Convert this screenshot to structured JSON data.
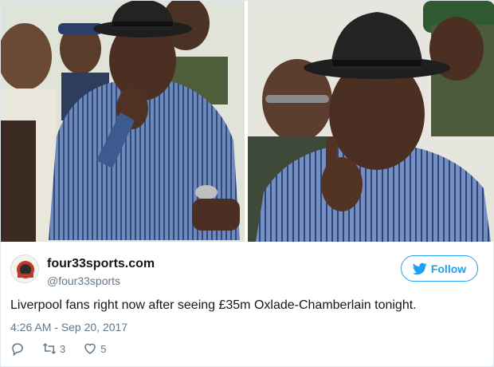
{
  "tweet": {
    "display_name": "four33sports.com",
    "handle": "@four33sports",
    "follow_label": "Follow",
    "text": "Liverpool fans right now after seeing £35m Oxlade-Chamberlain tonight.",
    "timestamp": "4:26 AM - Sep 20, 2017",
    "retweet_count": "3",
    "like_count": "5"
  },
  "avatar": {
    "logo_text": "four33sports"
  },
  "icons": {
    "follow": "twitter-bird-icon",
    "reply": "reply-icon",
    "retweet": "retweet-icon",
    "like": "heart-icon"
  },
  "colors": {
    "accent": "#1da1f2",
    "text": "#14171a",
    "muted": "#657786",
    "shirt_stripe": "#3f5f9a",
    "hat": "#1e1e1e"
  }
}
